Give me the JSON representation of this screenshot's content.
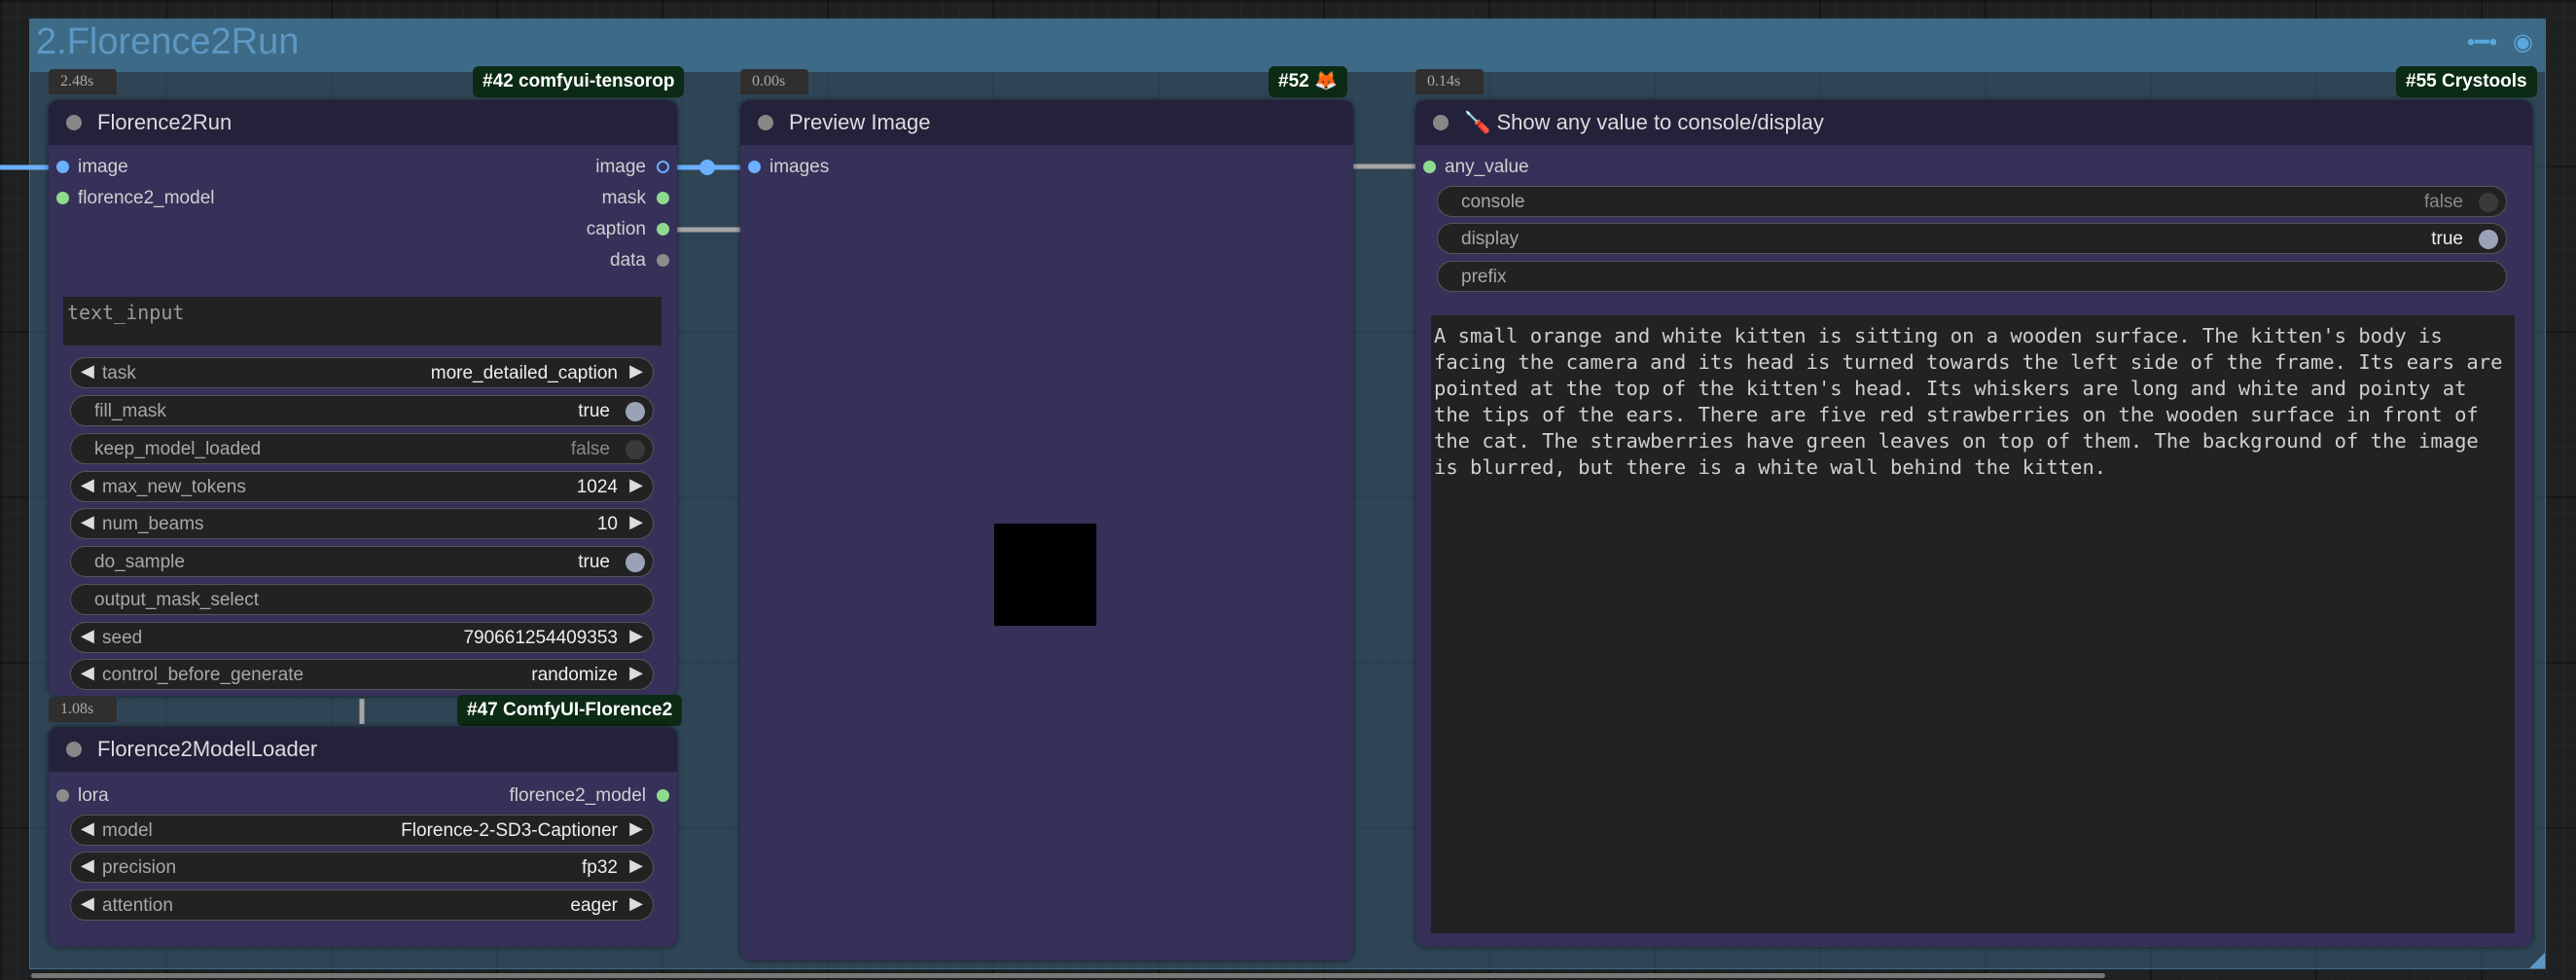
{
  "group": {
    "title": "2.Florence2Run"
  },
  "colors": {
    "node_bg": "#353159",
    "node_title_bg": "#24213b",
    "group_bg": "#3d6a86",
    "badge_bg": "#0c2b15",
    "image_slot": "#6ab0ff",
    "model_slot": "#8edb8e"
  },
  "florence_run": {
    "timing": "2.48s",
    "badge": "#42 comfyui-tensorop",
    "title": "Florence2Run",
    "inputs": [
      "image",
      "florence2_model"
    ],
    "outputs": [
      "image",
      "mask",
      "caption",
      "data"
    ],
    "text_placeholder": "text_input",
    "widgets": {
      "task": {
        "label": "task",
        "value": "more_detailed_caption"
      },
      "fill_mask": {
        "label": "fill_mask",
        "value": "true"
      },
      "keep_model_loaded": {
        "label": "keep_model_loaded",
        "value": "false"
      },
      "max_new_tokens": {
        "label": "max_new_tokens",
        "value": "1024"
      },
      "num_beams": {
        "label": "num_beams",
        "value": "10"
      },
      "do_sample": {
        "label": "do_sample",
        "value": "true"
      },
      "output_mask_select": {
        "label": "output_mask_select"
      },
      "seed": {
        "label": "seed",
        "value": "790661254409353"
      },
      "control_before_generate": {
        "label": "control_before_generate",
        "value": "randomize"
      }
    }
  },
  "model_loader": {
    "timing": "1.08s",
    "badge": "#47 ComfyUI-Florence2",
    "title": "Florence2ModelLoader",
    "input": "lora",
    "output": "florence2_model",
    "widgets": {
      "model": {
        "label": "model",
        "value": "Florence-2-SD3-Captioner"
      },
      "precision": {
        "label": "precision",
        "value": "fp32"
      },
      "attention": {
        "label": "attention",
        "value": "eager"
      }
    }
  },
  "preview": {
    "timing": "0.00s",
    "badge": "#52 🦊",
    "title": "Preview Image",
    "input": "images"
  },
  "show_any": {
    "timing": "0.14s",
    "badge": "#55 Crystools",
    "title": "🪛 Show any value to console/display",
    "input": "any_value",
    "widgets": {
      "console": {
        "label": "console",
        "value": "false"
      },
      "display": {
        "label": "display",
        "value": "true"
      },
      "prefix": {
        "label": "prefix"
      }
    },
    "text": "A small orange and white kitten is sitting on a wooden surface. The kitten's body is facing the camera and its head is turned towards the left side of the frame. Its ears are pointed at the top of the kitten's head. Its whiskers are long and white and pointy at the tips of the ears. There are five red strawberries on the wooden surface in front of the cat. The strawberries have green leaves on top of them. The background of the image is blurred, but there is a white wall behind the kitten."
  }
}
